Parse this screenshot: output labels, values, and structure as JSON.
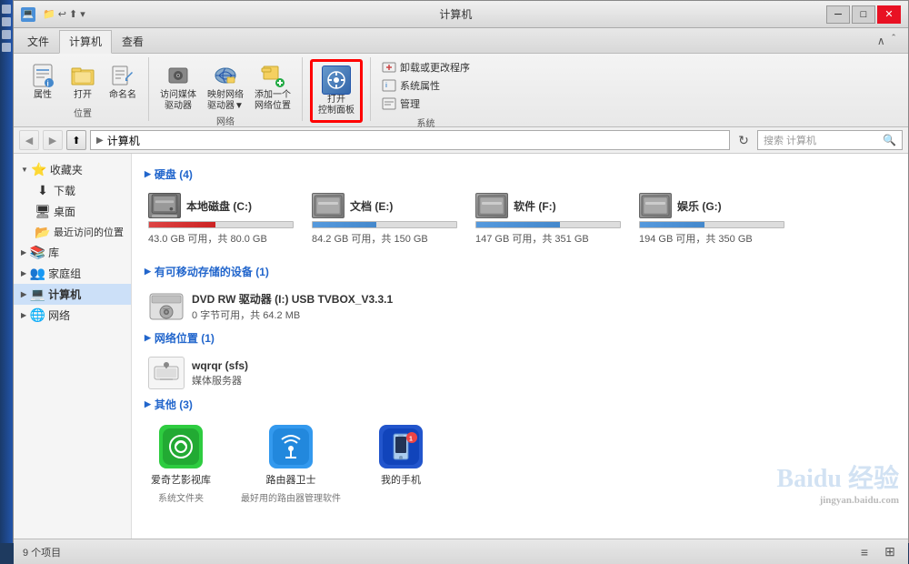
{
  "window": {
    "title": "计算机",
    "title_icon": "💻"
  },
  "title_bar": {
    "min_label": "─",
    "max_label": "□",
    "close_label": "✕",
    "quick_access_icons": [
      "📁",
      "↩",
      "⬆"
    ]
  },
  "ribbon": {
    "tabs": [
      "文件",
      "计算机",
      "查看"
    ],
    "active_tab": "计算机",
    "groups": {
      "location": {
        "label": "位置",
        "buttons": [
          {
            "id": "properties",
            "label": "属性",
            "icon": "🔧"
          },
          {
            "id": "open",
            "label": "打开",
            "icon": "📂"
          },
          {
            "id": "rename",
            "label": "命名名",
            "icon": "✏️"
          }
        ]
      },
      "network": {
        "label": "网络",
        "buttons": [
          {
            "id": "access",
            "label": "访问媒体\n驱动器",
            "icon": "💾"
          },
          {
            "id": "map",
            "label": "映射网络\n驱动器▼",
            "icon": "🗺"
          },
          {
            "id": "add",
            "label": "添加一个\n网络位置",
            "icon": "📍"
          }
        ]
      },
      "open_cp": {
        "label": "打开控制面板",
        "highlighted": true
      },
      "system": {
        "label": "系统",
        "items": [
          "卸载或更改程序",
          "系统属性",
          "管理"
        ]
      }
    }
  },
  "address_bar": {
    "back_disabled": true,
    "forward_disabled": true,
    "up_label": "⬆",
    "path_parts": [
      "计算机"
    ],
    "search_placeholder": "搜索 计算机",
    "refresh_icon": "↻"
  },
  "sidebar": {
    "sections": [
      {
        "label": "收藏夹",
        "icon": "⭐",
        "items": [
          {
            "label": "下载",
            "icon": "⬇"
          },
          {
            "label": "桌面",
            "icon": "🖥"
          },
          {
            "label": "最近访问的位置",
            "icon": "📂"
          }
        ]
      },
      {
        "label": "库",
        "icon": "📚",
        "items": []
      },
      {
        "label": "家庭组",
        "icon": "👥",
        "items": []
      },
      {
        "label": "计算机",
        "icon": "💻",
        "active": true,
        "items": []
      },
      {
        "label": "网络",
        "icon": "🌐",
        "items": []
      }
    ]
  },
  "content": {
    "hard_disks": {
      "section_title": "硬盘 (4)",
      "disks": [
        {
          "name": "本地磁盘 (C:)",
          "free": "43.0 GB 可用",
          "total": "共 80.0 GB",
          "bar_pct": 46,
          "low": false
        },
        {
          "name": "文档 (E:)",
          "free": "84.2 GB 可用",
          "total": "共 150 GB",
          "bar_pct": 44,
          "low": false
        },
        {
          "name": "软件 (F:)",
          "free": "147 GB 可用",
          "total": "共 351 GB",
          "bar_pct": 58,
          "low": false
        },
        {
          "name": "娱乐 (G:)",
          "free": "194 GB 可用",
          "total": "共 350 GB",
          "bar_pct": 45,
          "low": false
        }
      ]
    },
    "removable": {
      "section_title": "有可移动存储的设备 (1)",
      "devices": [
        {
          "name": "DVD RW 驱动器 (I:) USB TVBOX_V3.3.1",
          "detail": "0 字节可用，共 64.2 MB"
        }
      ]
    },
    "network_locations": {
      "section_title": "网络位置 (1)",
      "items": [
        {
          "name": "wqrqr (sfs)",
          "detail": "媒体服务器"
        }
      ]
    },
    "other": {
      "section_title": "其他 (3)",
      "items": [
        {
          "name": "爱奇艺影视库",
          "sub": "系统文件夹",
          "icon_type": "green",
          "icon": "🎬"
        },
        {
          "name": "路由器卫士",
          "sub": "最好用的路由器管理软件",
          "icon_type": "blue",
          "icon": "📡"
        },
        {
          "name": "我的手机",
          "sub": "",
          "icon_type": "phone",
          "icon": "📱"
        }
      ]
    }
  },
  "status_bar": {
    "count_label": "9 个项目",
    "view_icons": [
      "≡",
      "⊞"
    ]
  },
  "watermark": {
    "line1": "Baidu 经验",
    "line2": "jingyan.baidu.com"
  }
}
